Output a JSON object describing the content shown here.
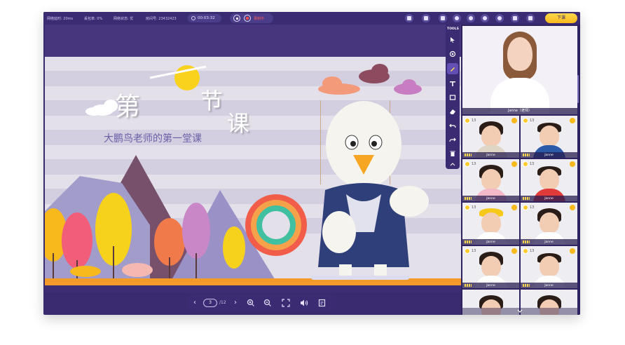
{
  "topbar": {
    "latency": "网络延时: 20ms",
    "packet_loss": "丢包率: 0%",
    "network": "网络状态: 优",
    "room": "房间号: 23432423",
    "time": "00:03:32",
    "recording_label": "录制中",
    "end_class_label": "下课"
  },
  "slide": {
    "title_chars": [
      "第",
      "一",
      "节",
      "课"
    ],
    "subtitle": "大鹏鸟老师的第一堂课"
  },
  "tools": {
    "title": "TOOLS",
    "items": [
      "pointer-icon",
      "target-icon",
      "pen-icon",
      "text-icon",
      "shape-icon",
      "eraser-icon",
      "undo-icon",
      "redo-icon",
      "delete-icon",
      "collapse-icon"
    ],
    "selected": "pen-icon"
  },
  "pager": {
    "current": "3",
    "total": "/12"
  },
  "teacher": {
    "name": "Janne（老师）"
  },
  "students": [
    {
      "coins": "13",
      "name": "Janne"
    },
    {
      "coins": "13",
      "name": "Janne"
    },
    {
      "coins": "13",
      "name": "Janne"
    },
    {
      "coins": "13",
      "name": "Janne"
    },
    {
      "coins": "13",
      "name": "Janne"
    },
    {
      "coins": "13",
      "name": "Janne"
    },
    {
      "coins": "13",
      "name": "Janne"
    },
    {
      "coins": "13",
      "name": "Janne"
    },
    {
      "coins": "13",
      "name": "Janne"
    },
    {
      "coins": "13",
      "name": "Janne"
    },
    {
      "coins": "",
      "name": ""
    },
    {
      "coins": "",
      "name": ""
    }
  ],
  "colors": {
    "frame": "#3a2a6e",
    "accent_yellow": "#f7b91c",
    "tool_selected": "#6450b5",
    "recording_red": "#ff5a5a"
  }
}
